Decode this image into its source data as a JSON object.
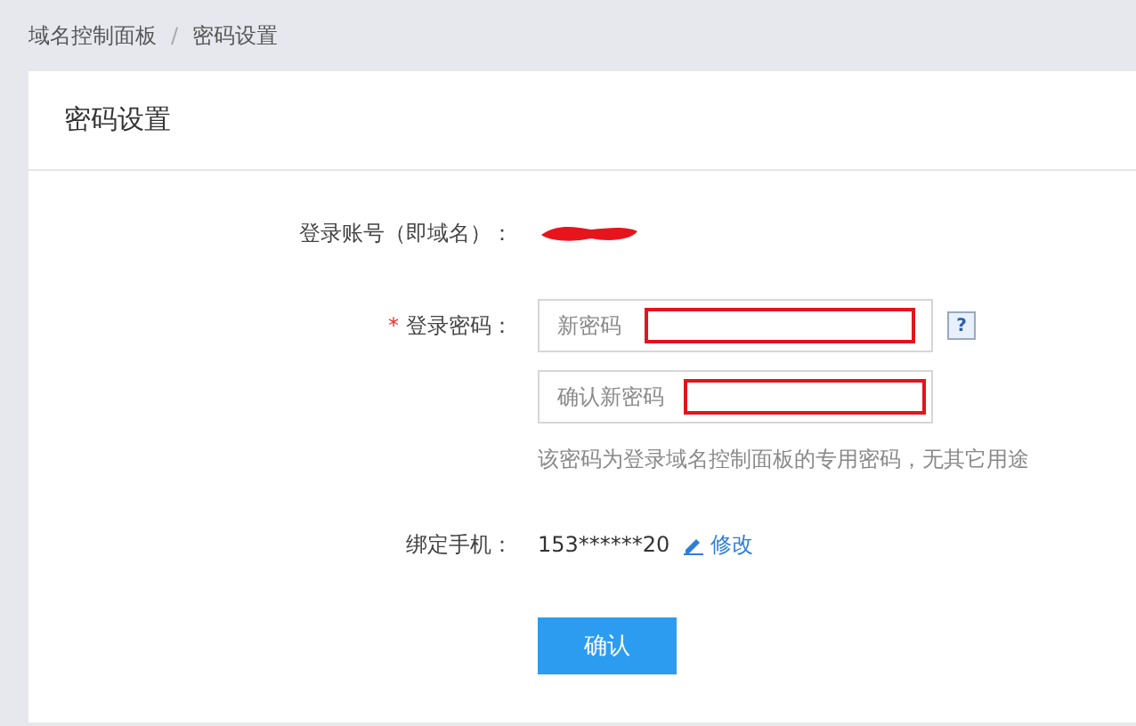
{
  "breadcrumb": [
    {
      "label": "域名控制面板"
    },
    {
      "label": "密码设置"
    }
  ],
  "breadcrumb_separator": "/",
  "card": {
    "title": "密码设置"
  },
  "form": [
    {
      "kind": "account",
      "label": "登录账号（即域名）："
    },
    {
      "kind": "password",
      "label": "登录密码：",
      "required": true,
      "required_mark": "*",
      "fields": [
        {
          "placeholder": "新密码",
          "help": "?"
        },
        {
          "placeholder": "确认新密码"
        }
      ],
      "hint": "该密码为登录域名控制面板的专用密码，无其它用途"
    },
    {
      "kind": "phone",
      "label": "绑定手机：",
      "value": "153******20",
      "link": "修改"
    }
  ],
  "submit": "确认"
}
